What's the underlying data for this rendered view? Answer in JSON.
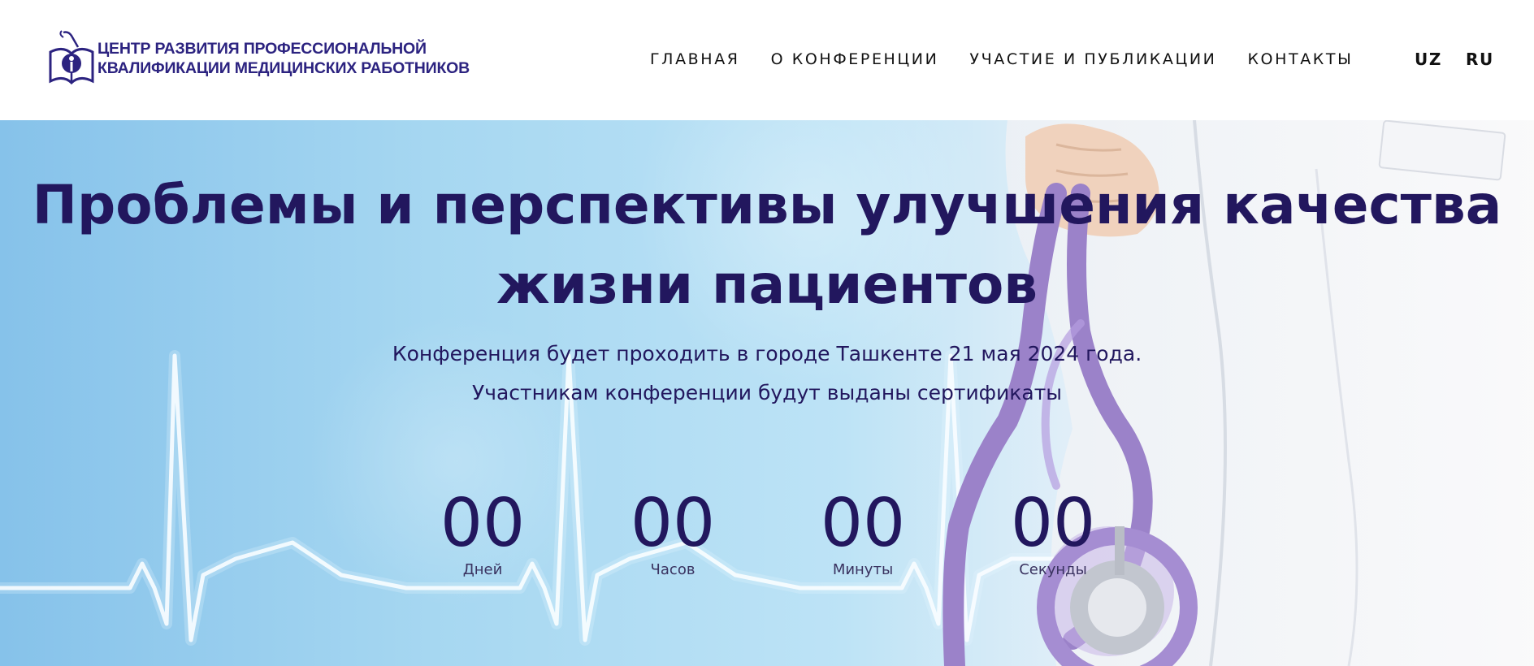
{
  "header": {
    "logo": {
      "line1": "ЦЕНТР РАЗВИТИЯ ПРОФЕССИОНАЛЬНОЙ",
      "line2": "КВАЛИФИКАЦИИ МЕДИЦИНСКИХ РАБОТНИКОВ"
    },
    "nav": [
      {
        "label": "ГЛАВНАЯ"
      },
      {
        "label": "О КОНФЕРЕНЦИИ"
      },
      {
        "label": "УЧАСТИЕ И ПУБЛИКАЦИИ"
      },
      {
        "label": "КОНТАКТЫ"
      }
    ],
    "languages": [
      {
        "label": "UZ"
      },
      {
        "label": "RU"
      }
    ]
  },
  "hero": {
    "title_line1": "Проблемы и перспективы улучшения качества",
    "title_line2": "жизни пациентов",
    "subtitle_line1": "Конференция будет проходить в городе Ташкенте 21 мая 2024 года.",
    "subtitle_line2": "Участникам конференции будут выданы сертификаты",
    "countdown": [
      {
        "value": "00",
        "label": "Дней"
      },
      {
        "value": "00",
        "label": "Часов"
      },
      {
        "value": "00",
        "label": "Минуты"
      },
      {
        "value": "00",
        "label": "Секунды"
      }
    ]
  },
  "colors": {
    "brand_navy": "#22175e",
    "logo_blue": "#2c2380",
    "sky_blue": "#86c2ea",
    "stethoscope_purple": "#9b82c9"
  },
  "icons": [
    "logo-emblem-icon",
    "ecg-line-icon",
    "stethoscope-icon"
  ]
}
